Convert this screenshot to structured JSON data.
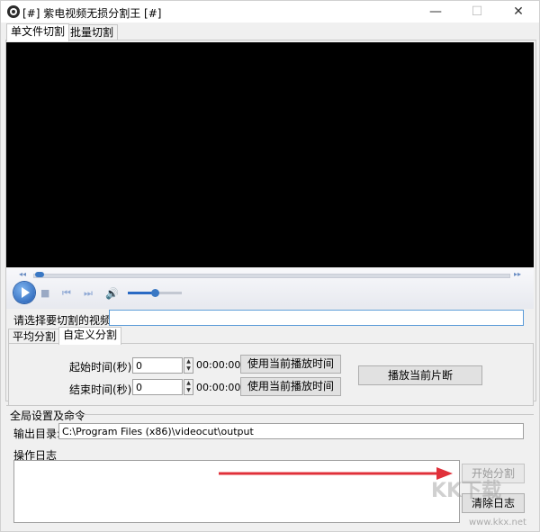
{
  "window": {
    "title": "[#] 紫电视频无损分割王 [#]",
    "minimize": "—",
    "maximize": "☐",
    "close": "✕"
  },
  "tabs": [
    {
      "label": "单文件切割",
      "active": true
    },
    {
      "label": "批量切割",
      "active": false
    }
  ],
  "player": {
    "seek_position_fraction": 0.01,
    "volume_fraction": 0.5
  },
  "file_select": {
    "label": "请选择要切割的视频:",
    "value": ""
  },
  "split_tabs": [
    {
      "label": "平均分割",
      "active": false
    },
    {
      "label": "自定义分割",
      "active": true
    }
  ],
  "custom_split": {
    "start_label": "起始时间(秒):",
    "start_value": "0",
    "start_display": "00:00:00",
    "end_label": "结束时间(秒):",
    "end_value": "0",
    "end_display": "00:00:00",
    "use_current_time_start": "使用当前播放时间",
    "use_current_time_end": "使用当前播放时间",
    "play_segment": "播放当前片断"
  },
  "global": {
    "group_label": "全局设置及命令",
    "output_label": "输出目录:",
    "output_value": "C:\\Program Files (x86)\\videocut\\output",
    "log_label": "操作日志",
    "log_text": "",
    "start_split": "开始分割",
    "clear_log": "清除日志"
  },
  "watermark": {
    "brand": "KK下载",
    "url": "www.kkx.net"
  },
  "colors": {
    "video_bg": "#000000",
    "accent": "#2a6ac4",
    "arrow": "#e0303a"
  }
}
